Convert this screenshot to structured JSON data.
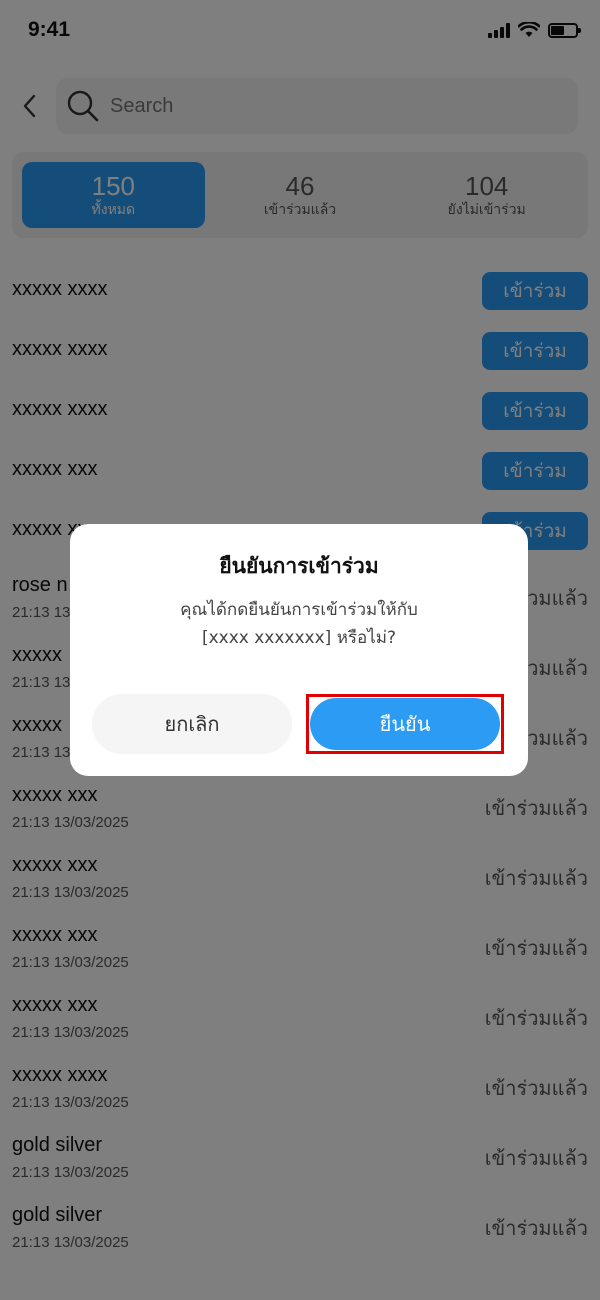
{
  "status_bar": {
    "time": "9:41",
    "icons": [
      "signal-icon",
      "wifi-icon",
      "battery-icon"
    ]
  },
  "header": {
    "back_icon": "chevron-left-icon",
    "search": {
      "placeholder": "Search",
      "value": "",
      "icon": "search-icon"
    }
  },
  "tabs": [
    {
      "count": "150",
      "label": "ทั้งหมด",
      "active": true
    },
    {
      "count": "46",
      "label": "เข้าร่วมแล้ว",
      "active": false
    },
    {
      "count": "104",
      "label": "ยังไม่เข้าร่วม",
      "active": false
    }
  ],
  "list": {
    "join_label": "เข้าร่วม",
    "joined_label": "เข้าร่วมแล้ว",
    "pending": [
      {
        "name": "xxxxx xxxx"
      },
      {
        "name": "xxxxx xxxx"
      },
      {
        "name": "xxxxx xxxx"
      },
      {
        "name": "xxxxx xxx"
      },
      {
        "name": "xxxxx xxxx"
      }
    ],
    "joined": [
      {
        "name": "rose n",
        "time": "21:13 13/03/2025"
      },
      {
        "name": "xxxxx",
        "time": "21:13 13/03/2025"
      },
      {
        "name": "xxxxx",
        "time": "21:13 13/03/2025"
      },
      {
        "name": "xxxxx xxx",
        "time": "21:13 13/03/2025"
      },
      {
        "name": "xxxxx xxx",
        "time": "21:13 13/03/2025"
      },
      {
        "name": "xxxxx xxx",
        "time": "21:13 13/03/2025"
      },
      {
        "name": "xxxxx xxx",
        "time": "21:13 13/03/2025"
      },
      {
        "name": "xxxxx xxxx",
        "time": "21:13 13/03/2025"
      },
      {
        "name": "gold silver",
        "time": "21:13 13/03/2025"
      },
      {
        "name": "gold silver",
        "time": "21:13 13/03/2025"
      }
    ]
  },
  "dialog": {
    "title": "ยืนยันการเข้าร่วม",
    "message_line1": "คุณได้กดยืนยันการเข้าร่วมให้กับ",
    "message_line2": "[xxxx xxxxxxx] หรือไม่?",
    "cancel_label": "ยกเลิก",
    "confirm_label": "ยืนยัน"
  },
  "colors": {
    "accent": "#2b9bf4",
    "highlight": "#e00000",
    "overlay": "rgba(0,0,0,0.5)"
  }
}
